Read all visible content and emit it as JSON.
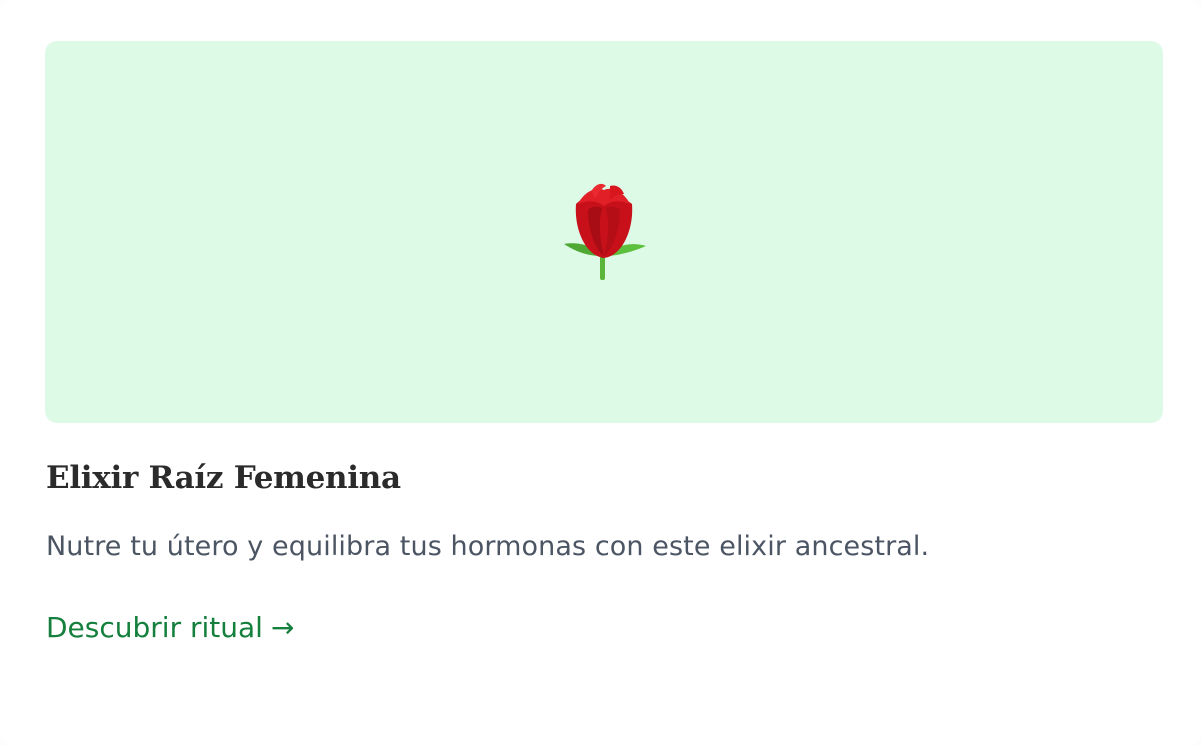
{
  "card": {
    "image": {
      "icon": "rose-icon",
      "background_color": "#dcfae6"
    },
    "title": "Elixir Raíz Femenina",
    "description": "Nutre tu útero y equilibra tus hormonas con este elixir ancestral.",
    "cta": {
      "label": "Descubrir ritual",
      "arrow": "→",
      "color": "#15803d"
    }
  }
}
